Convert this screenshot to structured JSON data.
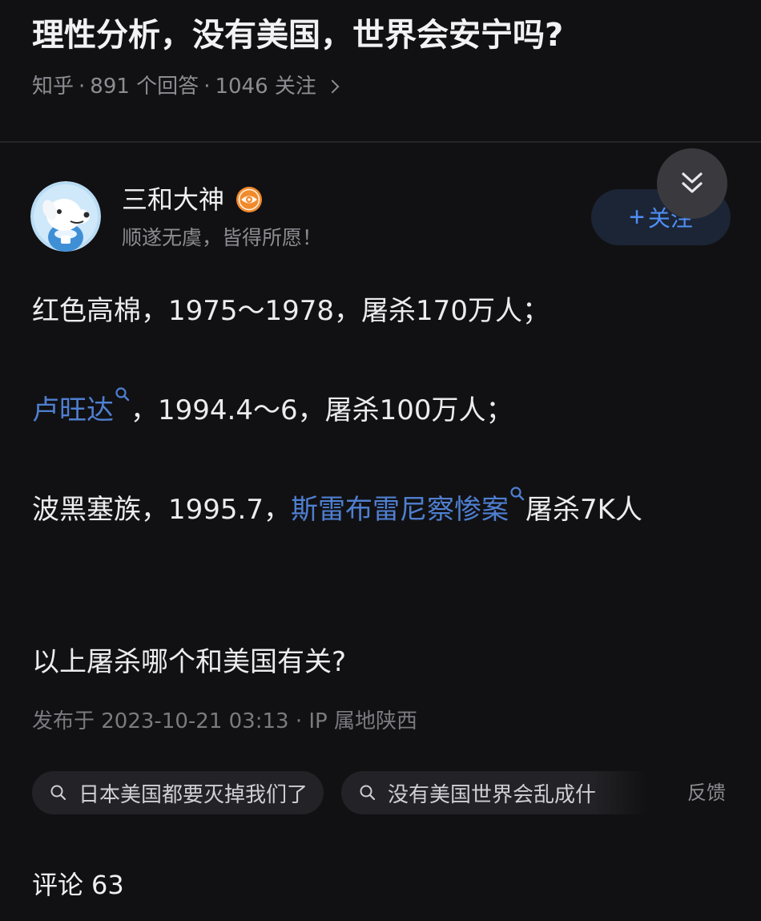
{
  "question": {
    "title": "理性分析，没有美国，世界会安宁吗?",
    "source": "知乎",
    "answers": "891 个回答",
    "follows": "1046 关注"
  },
  "author": {
    "name": "三和大神",
    "bio": "顺遂无虞，皆得所愿！",
    "follow_label": "关注",
    "badge_icon": "eye-badge-icon",
    "avatar_icon": "cartoon-dog-avatar"
  },
  "answer": {
    "p1": "红色高棉，1975～1978，屠杀170万人；",
    "p2_link": "卢旺达",
    "p2_rest": "，1994.4～6，屠杀100万人；",
    "p3_start": "波黑塞族，1995.7，",
    "p3_link": "斯雷布雷尼察惨案",
    "p3_rest": "屠杀7K人",
    "p4": "以上屠杀哪个和美国有关?",
    "publish_info": "发布于 2023-10-21 03:13 · IP 属地陕西"
  },
  "related_searches": [
    "日本美国都要灭掉我们了",
    "没有美国世界会乱成什"
  ],
  "feedback_label": "反馈",
  "comments": {
    "label": "评论",
    "count": "63"
  },
  "colors": {
    "background": "#111113",
    "link": "#4f7fd1",
    "follow_accent": "#4f8ef5",
    "badge": "#f08a2c"
  }
}
